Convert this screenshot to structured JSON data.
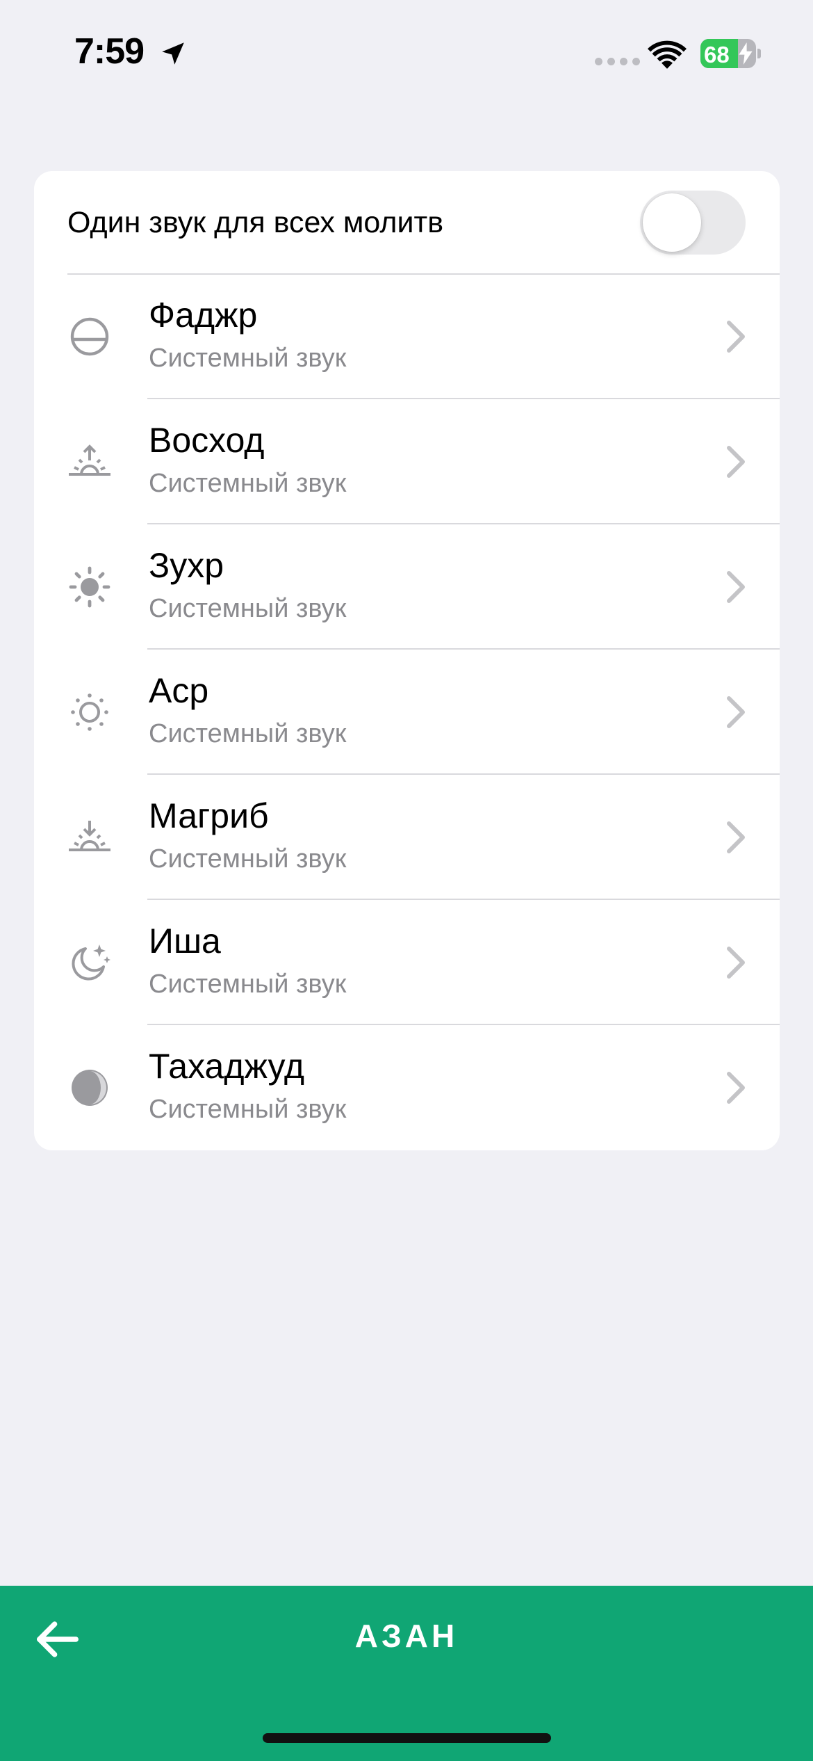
{
  "status_bar": {
    "time": "7:59",
    "battery_percent": 68,
    "battery_label": "68",
    "icons": [
      "location-arrow-icon",
      "signal-dots-icon",
      "wifi-icon",
      "battery-charging-icon"
    ]
  },
  "settings": {
    "same_sound_label": "Один звук для всех молитв",
    "same_sound_enabled": false
  },
  "prayers": [
    {
      "name": "Фаджр",
      "sound": "Системный звук",
      "icon": "horizon-circle-icon"
    },
    {
      "name": "Восход",
      "sound": "Системный звук",
      "icon": "sunrise-icon"
    },
    {
      "name": "Зухр",
      "sound": "Системный звук",
      "icon": "sun-filled-icon"
    },
    {
      "name": "Аср",
      "sound": "Системный звук",
      "icon": "sun-outline-icon"
    },
    {
      "name": "Магриб",
      "sound": "Системный звук",
      "icon": "sunset-icon"
    },
    {
      "name": "Иша",
      "sound": "Системный звук",
      "icon": "moon-stars-icon"
    },
    {
      "name": "Тахаджуд",
      "sound": "Системный звук",
      "icon": "half-moon-icon"
    }
  ],
  "bottom_bar": {
    "title": "АЗАН",
    "back_icon": "arrow-left-icon"
  },
  "colors": {
    "accent": "#10a674",
    "background": "#f0f0f5",
    "icon_gray": "#9a9a9e",
    "battery_green": "#34c759"
  }
}
